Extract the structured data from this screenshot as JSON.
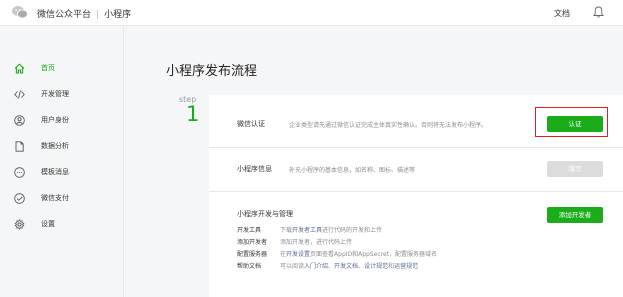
{
  "header": {
    "platform_name": "微信公众平台",
    "separator": "|",
    "section_name": "小程序",
    "docs_label": "文档"
  },
  "sidebar": {
    "items": [
      {
        "label": "首页",
        "icon": "home-icon",
        "active": true
      },
      {
        "label": "开发管理",
        "icon": "code-icon",
        "active": false
      },
      {
        "label": "用户身份",
        "icon": "user-icon",
        "active": false
      },
      {
        "label": "数据分析",
        "icon": "document-icon",
        "active": false
      },
      {
        "label": "模板消息",
        "icon": "message-icon",
        "active": false
      },
      {
        "label": "微信支付",
        "icon": "payment-icon",
        "active": false
      },
      {
        "label": "设置",
        "icon": "gear-icon",
        "active": false
      }
    ]
  },
  "main": {
    "title": "小程序发布流程",
    "step_label": "step",
    "step_number": "1",
    "rows": {
      "verify": {
        "title": "微信认证",
        "desc": "企业类型请先通过微信认证完成主体真实性确认。否则将无法发布小程序。",
        "button": "认证"
      },
      "info": {
        "title": "小程序信息",
        "desc": "补充小程序的基本信息，如名称、图标、描述等",
        "button": "填写"
      },
      "dev": {
        "title": "小程序开发与管理",
        "button": "添加开发者",
        "items": [
          {
            "key": "开发工具",
            "pre": "下载",
            "link": "开发者工具",
            "post": "进行代码的开发和上传"
          },
          {
            "key": "添加开发者",
            "pre": "添加开发者，进行代码上传",
            "link": "",
            "post": ""
          },
          {
            "key": "配置服务器",
            "pre": "在",
            "link": "开发设置",
            "post": "页面查看AppID和AppSecret，配置服务器域名"
          }
        ],
        "help": {
          "key": "帮助文档",
          "pre": "可以阅读",
          "link1": "入门介绍",
          "sep1": "、",
          "link2": "开发文档",
          "sep2": "、",
          "link3": "设计规范",
          "mid": "和",
          "link4": "运营规范"
        }
      }
    }
  },
  "colors": {
    "accent": "#1aad19",
    "highlight": "#e02020",
    "link": "#576b95"
  }
}
